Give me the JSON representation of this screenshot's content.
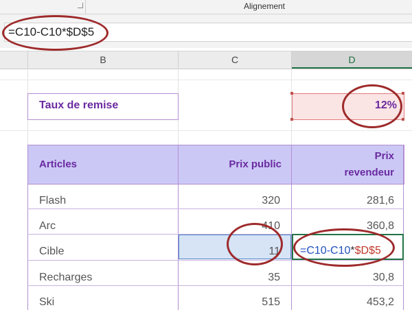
{
  "ribbon": {
    "group_label": "Alignement"
  },
  "formula_bar": {
    "formula": "=C10-C10*$D$5"
  },
  "columns": {
    "b": "B",
    "c": "C",
    "d": "D"
  },
  "rate": {
    "label": "Taux de remise",
    "value": "12%"
  },
  "table": {
    "headers": {
      "articles": "Articles",
      "prix_public": "Prix public",
      "prix_revendeur_1": "Prix",
      "prix_revendeur_2": "revendeur"
    },
    "rows": [
      {
        "article": "Flash",
        "prix_public": "320",
        "prix_revendeur": "281,6"
      },
      {
        "article": "Arc",
        "prix_public": "410",
        "prix_revendeur": "360,8"
      },
      {
        "article": "Cible",
        "prix_public": "11",
        "prix_revendeur": ""
      },
      {
        "article": "Recharges",
        "prix_public": "35",
        "prix_revendeur": "30,8"
      },
      {
        "article": "Ski",
        "prix_public": "515",
        "prix_revendeur": "453,2"
      }
    ]
  },
  "cell_edit": {
    "eq": "=",
    "ref1": "C10",
    "minus": "-",
    "ref2": "C10",
    "times": "*",
    "ref3": "$D$5"
  },
  "colors": {
    "accent_purple": "#6a2aa0",
    "header_fill": "#cbc8f6",
    "annotation": "#9e2a2b",
    "excel_green": "#217346"
  }
}
